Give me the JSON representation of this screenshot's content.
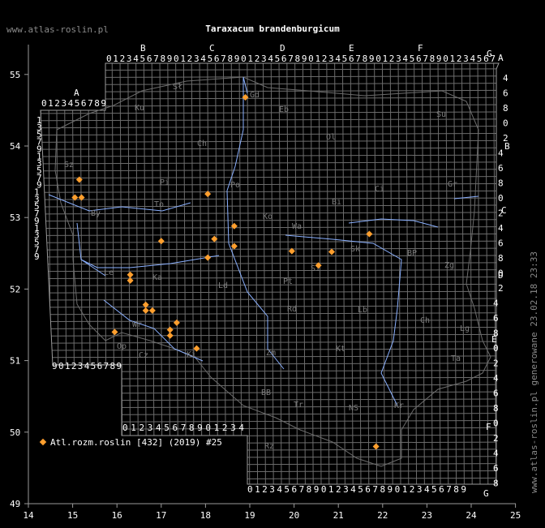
{
  "site": "www.atlas-roslin.pl",
  "title": "Taraxacum brandenburgicum",
  "generated": "www.atlas-roslin.pl generowane 23.02.18 23:33",
  "legend": "Atl.rozm.roslin [432] (2019) #25",
  "colors": {
    "background": "#000000",
    "grid": "#6c6c6c",
    "border": "#9a9a9a",
    "rivers": "#8ab0ff",
    "points": "#ff9f2e",
    "text": "#ffffff",
    "region_text": "#7c7c7c"
  },
  "axes": {
    "x_ticks": [
      "14",
      "15",
      "16",
      "17",
      "18",
      "19",
      "20",
      "21",
      "22",
      "23",
      "24",
      "25"
    ],
    "y_ticks": [
      "55",
      "54",
      "53",
      "52",
      "51",
      "50",
      "49"
    ],
    "lon_range": [
      14,
      25
    ],
    "lat_range": [
      49,
      55.5
    ]
  },
  "grid_letters_top": [
    "A",
    "B",
    "C",
    "D",
    "E",
    "F",
    "G"
  ],
  "grid_letters_right": [
    "A",
    "B",
    "C",
    "D",
    "E",
    "F",
    "G"
  ],
  "digits": {
    "top_row": "0123456789012345678901234567890123456789012345678901234567",
    "left_col": [
      "1",
      "3",
      "5",
      "7",
      "9",
      "1",
      "3",
      "5",
      "7",
      "9",
      "1",
      "3",
      "5",
      "7",
      "9",
      "1",
      "3",
      "5",
      "7",
      "9"
    ],
    "right_col": [
      "4",
      "6",
      "8",
      "0",
      "2",
      "4",
      "6",
      "8",
      "0",
      "2",
      "4",
      "6",
      "8",
      "0",
      "2",
      "4",
      "6",
      "8",
      "0",
      "2",
      "4",
      "6",
      "8",
      "0",
      "2",
      "4",
      "6",
      "8"
    ],
    "bottom_row": "0123456789012345678901234567890123456789"
  },
  "regions": [
    "Sł",
    "Ku",
    "Ch",
    "Gd",
    "Eb",
    "Ol",
    "Su",
    "Sz",
    "Pi",
    "By",
    "To",
    "Ci",
    "Bi",
    "Gr",
    "Po",
    "Ko",
    "Wa",
    "Sk",
    "Si",
    "BP",
    "Zg",
    "Le",
    "Ka",
    "Ld",
    "Pt",
    "Rd",
    "Lb",
    "Ch",
    "Lg",
    "Wr",
    "Op",
    "Cz",
    "Ki",
    "Zm",
    "Kt",
    "Ta",
    "BB",
    "Tr",
    "Rz",
    "NS",
    "Kr"
  ],
  "points": [
    {
      "lon": 18.9,
      "lat": 54.68
    },
    {
      "lon": 15.15,
      "lat": 53.53
    },
    {
      "lon": 15.05,
      "lat": 53.28
    },
    {
      "lon": 15.2,
      "lat": 53.28
    },
    {
      "lon": 18.05,
      "lat": 53.33
    },
    {
      "lon": 18.65,
      "lat": 52.88
    },
    {
      "lon": 18.2,
      "lat": 52.7
    },
    {
      "lon": 17.0,
      "lat": 52.67
    },
    {
      "lon": 18.65,
      "lat": 52.6
    },
    {
      "lon": 19.95,
      "lat": 52.53
    },
    {
      "lon": 20.85,
      "lat": 52.52
    },
    {
      "lon": 18.05,
      "lat": 52.44
    },
    {
      "lon": 20.55,
      "lat": 52.33
    },
    {
      "lon": 21.7,
      "lat": 52.77
    },
    {
      "lon": 16.3,
      "lat": 52.2
    },
    {
      "lon": 16.3,
      "lat": 52.12
    },
    {
      "lon": 16.65,
      "lat": 51.78
    },
    {
      "lon": 16.65,
      "lat": 51.7
    },
    {
      "lon": 16.8,
      "lat": 51.7
    },
    {
      "lon": 17.35,
      "lat": 51.53
    },
    {
      "lon": 17.2,
      "lat": 51.43
    },
    {
      "lon": 17.2,
      "lat": 51.35
    },
    {
      "lon": 15.95,
      "lat": 51.4
    },
    {
      "lon": 17.8,
      "lat": 51.17
    },
    {
      "lon": 21.85,
      "lat": 49.8
    }
  ]
}
